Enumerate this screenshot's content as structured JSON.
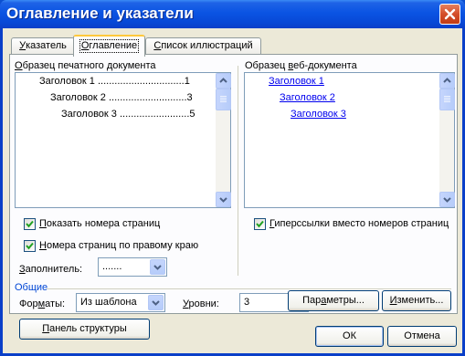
{
  "window": {
    "title": "Оглавление и указатели"
  },
  "tabs": [
    {
      "label": "Указатель",
      "accel": "У",
      "rest": "казатель"
    },
    {
      "label": "Оглавление",
      "accel": "О",
      "rest": "главление"
    },
    {
      "label": "Список иллюстраций",
      "accel": "С",
      "rest": "писок иллюстраций"
    }
  ],
  "print_preview": {
    "label": "Образец печатного документа",
    "accel": "О",
    "rest": "бразец печатного документа",
    "lines": [
      {
        "text": "Заголовок 1",
        "dots": "...............................",
        "page": "1"
      },
      {
        "text": "Заголовок 2",
        "dots": "............................",
        "page": "3"
      },
      {
        "text": "Заголовок 3",
        "dots": ".........................",
        "page": "5"
      }
    ]
  },
  "web_preview": {
    "label_pre": "Образец ",
    "accel": "в",
    "label_post": "еб-документа",
    "links": [
      "Заголовок 1",
      "Заголовок 2",
      "Заголовок 3"
    ]
  },
  "options": {
    "show_page_numbers": {
      "pre": "",
      "accel": "П",
      "post": "оказать номера страниц",
      "checked": true
    },
    "right_align": {
      "pre": "",
      "accel": "Н",
      "post": "омера страниц по правому краю",
      "checked": true
    },
    "hyperlinks": {
      "pre": "",
      "accel": "Г",
      "post": "иперссылки вместо номеров страниц",
      "checked": true
    },
    "leader_label": {
      "pre": "",
      "accel": "З",
      "post": "аполнитель:"
    },
    "leader_value": "......."
  },
  "general": {
    "title": "Общие",
    "formats_label": {
      "pre": "Фор",
      "accel": "м",
      "post": "аты:"
    },
    "formats_value": "Из шаблона",
    "levels_label": {
      "pre": "",
      "accel": "У",
      "post": "ровни:"
    },
    "levels_value": "3"
  },
  "buttons": {
    "outline": {
      "pre": "",
      "accel": "П",
      "post": "анель структуры"
    },
    "params": {
      "pre": "Пар",
      "accel": "а",
      "post": "метры..."
    },
    "modify": {
      "pre": "",
      "accel": "И",
      "post": "зменить..."
    },
    "ok": "ОК",
    "cancel": "Отмена"
  }
}
